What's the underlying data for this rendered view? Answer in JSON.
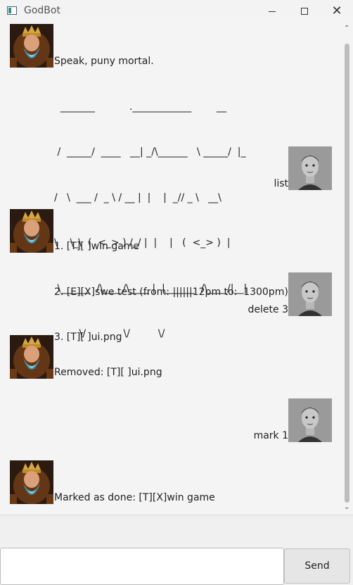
{
  "window": {
    "title": "GodBot",
    "controls": {
      "minimize": "minimize-icon",
      "maximize": "maximize-icon",
      "close": "close-icon"
    }
  },
  "messages": [
    {
      "sender": "bot",
      "avatar": "god-avatar",
      "lines": [
        "Speak, puny mortal.",
        "  _______           .____________        __",
        " /  _____/  ____   __| _/\\______   \\ _____/  |_",
        "/   \\  ___ /  _ \\ / __ |  |    |  _// _ \\   __\\",
        "\\    \\_\\  (  <_> ) /_/ |  |    |   (  <_> )  |",
        " \\______  /\\____/\\____ |  |______  /\\____/|__|",
        "        \\/            \\/         \\/"
      ]
    },
    {
      "sender": "user",
      "avatar": "user-avatar",
      "lines": [
        "list"
      ]
    },
    {
      "sender": "bot",
      "avatar": "god-avatar",
      "lines": [
        "1. [T][ ]win game",
        "2. [E][X]swe test (from: ||||||12pm to:  1300pm)",
        "3. [T][ ]ui.png"
      ]
    },
    {
      "sender": "user",
      "avatar": "user-avatar",
      "lines": [
        "delete 3"
      ]
    },
    {
      "sender": "bot",
      "avatar": "god-avatar",
      "lines": [
        "Removed: [T][ ]ui.png"
      ]
    },
    {
      "sender": "user",
      "avatar": "user-avatar",
      "lines": [
        "mark 1"
      ]
    },
    {
      "sender": "bot",
      "avatar": "god-avatar",
      "lines": [
        "Marked as done: [T][X]win game"
      ]
    }
  ],
  "input": {
    "value": "",
    "placeholder": ""
  },
  "send_label": "Send"
}
